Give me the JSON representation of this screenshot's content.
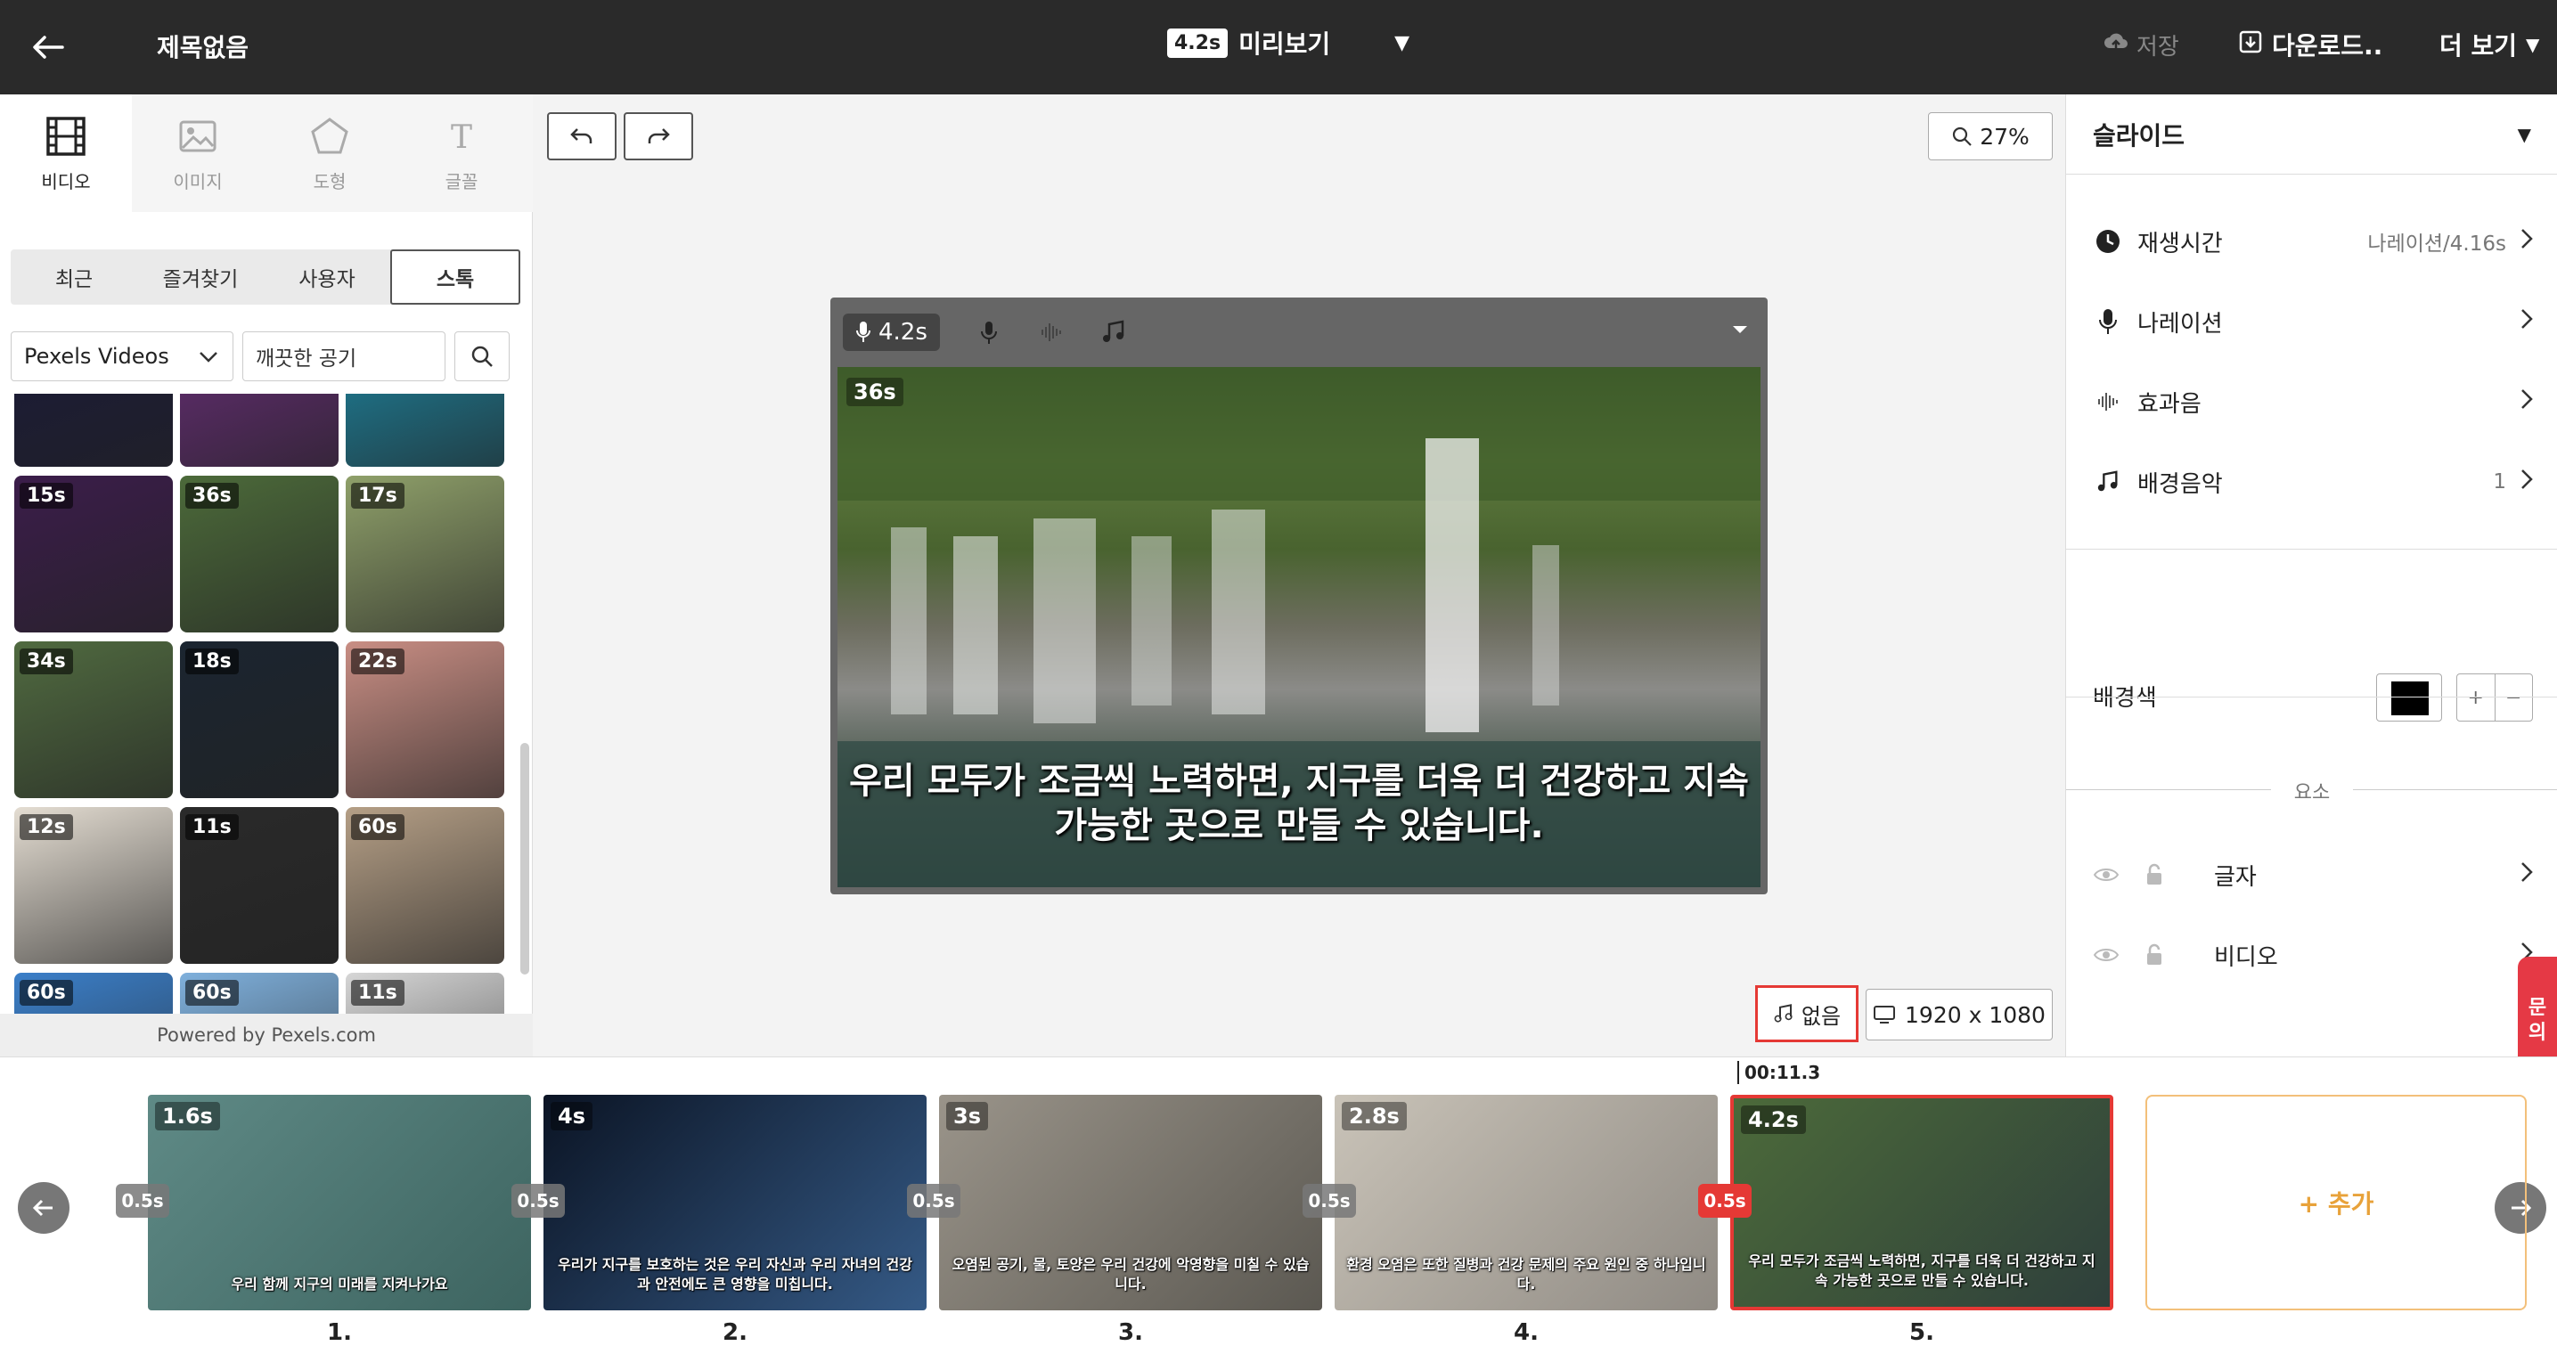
{
  "header": {
    "title": "제목없음",
    "preview_duration": "4.2s",
    "preview_label": "미리보기",
    "save_label": "저장",
    "download_label": "다운로드..",
    "more_label": "더 보기"
  },
  "categories": [
    {
      "label": "비디오",
      "icon": "film-icon",
      "active": true
    },
    {
      "label": "이미지",
      "icon": "image-icon",
      "active": false
    },
    {
      "label": "도형",
      "icon": "pentagon-icon",
      "active": false
    },
    {
      "label": "글꼴",
      "icon": "text-icon",
      "active": false
    }
  ],
  "source_tabs": [
    "최근",
    "즐겨찾기",
    "사용자",
    "스톡"
  ],
  "search": {
    "provider": "Pexels Videos",
    "query": "깨끗한 공기"
  },
  "thumbnails": [
    {
      "duration": "",
      "color": "#1a1a3a"
    },
    {
      "duration": "",
      "color": "#6a2e7a"
    },
    {
      "duration": "",
      "color": "#1d8aa6"
    },
    {
      "duration": "15s",
      "color": "#3b1d4a"
    },
    {
      "duration": "36s",
      "color": "#4c6a3a"
    },
    {
      "duration": "17s",
      "color": "#8fa06a"
    },
    {
      "duration": "34s",
      "color": "#506a40"
    },
    {
      "duration": "18s",
      "color": "#1b2530"
    },
    {
      "duration": "22s",
      "color": "#c98e84"
    },
    {
      "duration": "12s",
      "color": "#e4ddd2"
    },
    {
      "duration": "11s",
      "color": "#2a2a2a"
    },
    {
      "duration": "60s",
      "color": "#b59f86"
    },
    {
      "duration": "60s",
      "color": "#3b7fc9"
    },
    {
      "duration": "60s",
      "color": "#7fb0dc"
    },
    {
      "duration": "11s",
      "color": "#d6d6d6"
    }
  ],
  "powered_by": "Powered by Pexels.com",
  "canvas": {
    "zoom": "27%",
    "slide_duration": "4.2s",
    "video_duration": "36s",
    "subtitle_line1": "우리 모두가 조금씩 노력하면, 지구를 더욱 더 건강하고 지속",
    "subtitle_line2": "가능한 곳으로 만들 수 있습니다.",
    "music_label": "없음",
    "resolution": "1920 x 1080"
  },
  "right_panel": {
    "heading": "슬라이드",
    "rows": [
      {
        "label": "재생시간",
        "value": "나레이션/4.16s",
        "icon": "clock-icon"
      },
      {
        "label": "나레이션",
        "value": "",
        "icon": "microphone-icon"
      },
      {
        "label": "효과음",
        "value": "",
        "icon": "waveform-icon"
      },
      {
        "label": "배경음악",
        "value": "1",
        "icon": "music-note-icon"
      }
    ],
    "bg_color_label": "배경색",
    "bg_color": "#000000",
    "plus": "+",
    "minus": "−",
    "elements_label": "요소",
    "elements": [
      {
        "label": "글자"
      },
      {
        "label": "비디오"
      }
    ],
    "inquiry_label": "문의"
  },
  "timeline": {
    "time_marker": "00:11.3",
    "slides": [
      {
        "num": "1.",
        "duration": "1.6s",
        "caption": "우리 함께 지구의 미래를 지켜나가요",
        "color_a": "#5f8a86",
        "color_b": "#3d6460",
        "active": false
      },
      {
        "num": "2.",
        "duration": "4s",
        "caption": "우리가 지구를 보호하는 것은 우리 자신과 우리 자녀의 건강과 안전에도 큰 영향을 미칩니다.",
        "color_a": "#0b1424",
        "color_b": "#355a86",
        "active": false
      },
      {
        "num": "3.",
        "duration": "3s",
        "caption": "오염된 공기, 물, 토양은 우리 건강에 악영향을 미칠 수 있습니다.",
        "color_a": "#9a948a",
        "color_b": "#5b5851",
        "active": false
      },
      {
        "num": "4.",
        "duration": "2.8s",
        "caption": "환경 오염은 또한 질병과 건강 문제의 주요 원인 중 하나입니다.",
        "color_a": "#c9c3b8",
        "color_b": "#8f8a83",
        "active": false
      },
      {
        "num": "5.",
        "duration": "4.2s",
        "caption": "우리 모두가 조금씩 노력하면, 지구를 더욱 더 건강하고 지속 가능한 곳으로 만들 수 있습니다.",
        "color_a": "#4c6a3a",
        "color_b": "#2e3f3b",
        "active": true
      }
    ],
    "transitions": [
      "0.5s",
      "0.5s",
      "0.5s",
      "0.5s",
      "0.5s"
    ],
    "add_label": "+ 추가"
  }
}
